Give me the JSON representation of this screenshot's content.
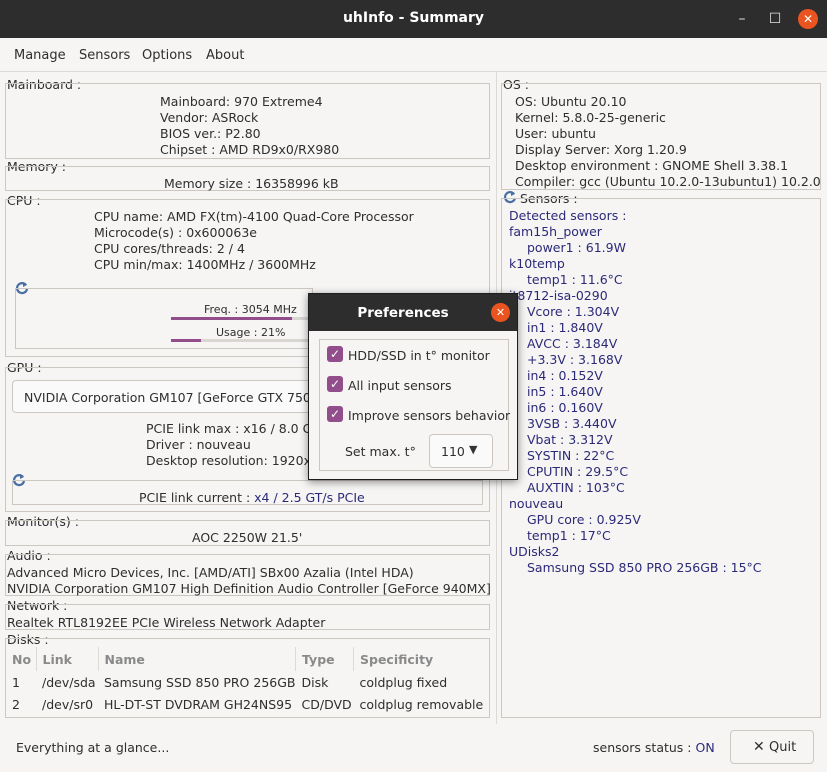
{
  "window": {
    "title": "uhInfo - Summary"
  },
  "menu": [
    "Manage",
    "Sensors",
    "Options",
    "About"
  ],
  "mainboard": {
    "title": "Mainboard :",
    "lines": [
      "Mainboard: 970 Extreme4",
      "Vendor: ASRock",
      "BIOS ver.: P2.80",
      "Chipset : AMD RD9x0/RX980"
    ]
  },
  "memory": {
    "title": "Memory :",
    "size": "Memory size : 16358996 kB"
  },
  "cpu": {
    "title": "CPU :",
    "lines": [
      "CPU name: AMD FX(tm)-4100 Quad-Core Processor",
      "Microcode(s) : 0x600063e",
      "CPU cores/threads: 2 / 4",
      "CPU min/max: 1400MHz / 3600MHz"
    ],
    "freq_label": "Freq. : 3054 MHz",
    "freq_fraction": 0.85,
    "usage_label": "Usage : 21%",
    "usage_fraction": 0.21
  },
  "gpu": {
    "title": "GPU :",
    "selected": "NVIDIA Corporation GM107 [GeForce GTX 750",
    "lines": [
      "PCIE link max : x16 / 8.0 GT/",
      "Driver : nouveau",
      "Desktop resolution: 1920x"
    ],
    "pcie_current_label": "PCIE link current : ",
    "pcie_current_value": "x4 / 2.5 GT/s PCIe"
  },
  "monitors": {
    "title": "Monitor(s) :",
    "value": "AOC 2250W  21.5'"
  },
  "audio": {
    "title": "Audio :",
    "lines": [
      "Advanced Micro Devices, Inc. [AMD/ATI] SBx00 Azalia (Intel HDA)",
      "NVIDIA Corporation GM107 High Definition Audio Controller [GeForce 940MX]"
    ]
  },
  "network": {
    "title": "Network :",
    "value": "Realtek RTL8192EE PCIe Wireless Network Adapter"
  },
  "disks": {
    "title": "Disks :",
    "columns": [
      "No",
      "Link",
      "Name",
      "Type",
      "Specificity"
    ],
    "rows": [
      [
        "1",
        "/dev/sda",
        "Samsung SSD 850 PRO 256GB",
        "Disk",
        "coldplug  fixed"
      ],
      [
        "2",
        "/dev/sr0",
        "HL-DT-ST DVDRAM GH24NS95",
        "CD/DVD",
        "coldplug  removable"
      ]
    ]
  },
  "os": {
    "title": "OS :",
    "lines": [
      "OS: Ubuntu 20.10",
      "Kernel: 5.8.0-25-generic",
      "User: ubuntu",
      "Display Server: Xorg 1.20.9",
      "Desktop environment : GNOME Shell 3.38.1",
      "Compiler: gcc (Ubuntu 10.2.0-13ubuntu1) 10.2.0"
    ]
  },
  "sensors": {
    "title": "Sensors :",
    "lines": [
      {
        "text": "Detected sensors :",
        "indent": 0
      },
      {
        "text": "fam15h_power",
        "indent": 0
      },
      {
        "text": "power1 : 61.9W",
        "indent": 1
      },
      {
        "text": "k10temp",
        "indent": 0
      },
      {
        "text": "temp1 : 11.6°C",
        "indent": 1
      },
      {
        "text": "it8712-isa-0290",
        "indent": 0
      },
      {
        "text": "Vcore : 1.304V",
        "indent": 1
      },
      {
        "text": "in1 : 1.840V",
        "indent": 1
      },
      {
        "text": "AVCC : 3.184V",
        "indent": 1
      },
      {
        "text": "+3.3V : 3.168V",
        "indent": 1
      },
      {
        "text": "in4 : 0.152V",
        "indent": 1
      },
      {
        "text": "in5 : 1.640V",
        "indent": 1
      },
      {
        "text": "in6 : 0.160V",
        "indent": 1
      },
      {
        "text": "3VSB : 3.440V",
        "indent": 1
      },
      {
        "text": "Vbat : 3.312V",
        "indent": 1
      },
      {
        "text": "SYSTIN : 22°C",
        "indent": 1
      },
      {
        "text": "CPUTIN : 29.5°C",
        "indent": 1
      },
      {
        "text": "AUXTIN : 103°C",
        "indent": 1
      },
      {
        "text": "nouveau",
        "indent": 0
      },
      {
        "text": "GPU core : 0.925V",
        "indent": 1
      },
      {
        "text": "temp1 : 17°C",
        "indent": 1
      },
      {
        "text": "UDisks2",
        "indent": 0
      },
      {
        "text": "Samsung SSD 850 PRO 256GB : 15°C",
        "indent": 1
      }
    ]
  },
  "status": {
    "left": "Everything at a glance...",
    "sensors_label": "sensors status : ",
    "sensors_value": "ON",
    "quit": "Quit"
  },
  "preferences": {
    "title": "Preferences",
    "options": [
      {
        "label": "HDD/SSD in t° monitor",
        "checked": true
      },
      {
        "label": "All input sensors",
        "checked": true
      },
      {
        "label": "Improve sensors behavior",
        "checked": true
      }
    ],
    "max_label": "Set max. t°",
    "max_value": "110"
  },
  "colors": {
    "accent": "#924d8b",
    "close": "#e95420",
    "value_text": "#2b2a78"
  }
}
